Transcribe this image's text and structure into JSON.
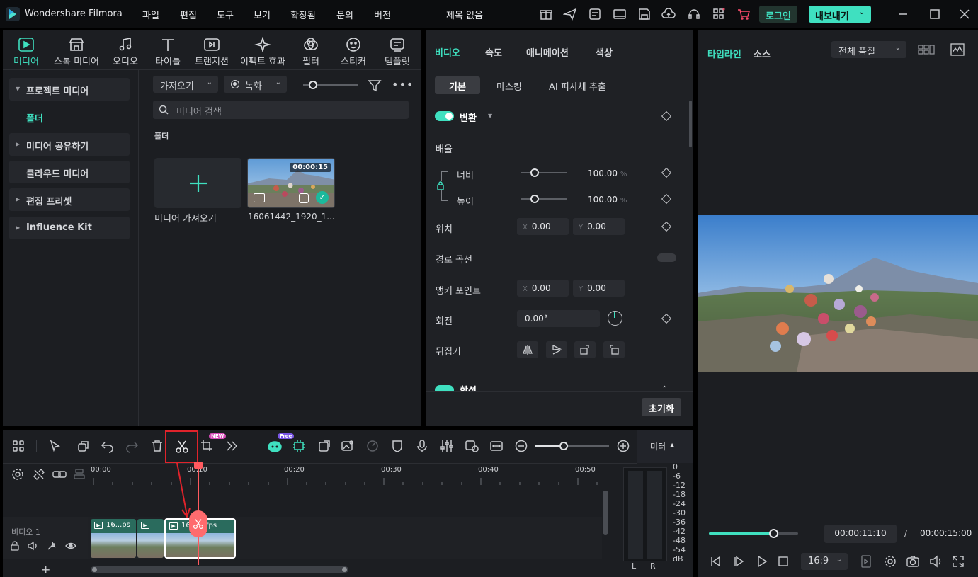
{
  "app": {
    "name": "Wondershare Filmora",
    "project_title": "제목 없음",
    "login_label": "로그인",
    "export_label": "내보내기"
  },
  "menu": [
    "파일",
    "편집",
    "도구",
    "보기",
    "확장됨",
    "문의",
    "버전"
  ],
  "tool_tabs": [
    "미디어",
    "스톡 미디어",
    "오디오",
    "타이틀",
    "트랜지션",
    "이펙트 효과",
    "필터",
    "스티커",
    "템플릿"
  ],
  "sidebar": {
    "project_media": "프로젝트 미디어",
    "folder": "폴더",
    "share_media": "미디어 공유하기",
    "cloud_media": "클라우드 미디어",
    "edit_preset": "편집 프리셋",
    "influence_kit": "Influence Kit"
  },
  "media": {
    "import_label": "가져오기",
    "record_label": "녹화",
    "search_placeholder": "미디어 검색",
    "folder_heading": "폴더",
    "import_media_label": "미디어 가져오기",
    "clip_name": "16061442_1920_1...",
    "clip_duration": "00:00:15"
  },
  "properties": {
    "tabs": [
      "비디오",
      "속도",
      "애니메이션",
      "색상"
    ],
    "subtabs": [
      "기본",
      "마스킹",
      "AI 피사체 추출"
    ],
    "transform_label": "변환",
    "scale_label": "배율",
    "width_label": "너비",
    "height_label": "높이",
    "width_value": "100.00",
    "height_value": "100.00",
    "percent_unit": "%",
    "position_label": "위치",
    "position_x": "0.00",
    "position_y": "0.00",
    "axis_x": "X",
    "axis_y": "Y",
    "path_curve_label": "경로 곡선",
    "anchor_label": "앵커 포인트",
    "anchor_x": "0.00",
    "anchor_y": "0.00",
    "rotate_label": "회전",
    "rotate_value": "0.00°",
    "flip_label": "뒤집기",
    "composite_label": "합성",
    "reset_label": "초기화"
  },
  "preview": {
    "tabs": [
      "타임라인",
      "소스"
    ],
    "quality_label": "전체 품질",
    "current_time": "00:00:11:10",
    "separator": "/",
    "total_time": "00:00:15:00",
    "aspect_ratio": "16:9",
    "progress": 0.72
  },
  "timeline": {
    "meter_label": "미터",
    "new_badge": "NEW",
    "free_badge": "Free",
    "ruler": [
      "00:00",
      "00:10",
      "00:20",
      "00:30",
      "00:40",
      "00:50"
    ],
    "track_label": "비디오 1",
    "clips": [
      "16...ps",
      "",
      "16...60fps"
    ],
    "db_scale": [
      "0",
      "-6",
      "-12",
      "-18",
      "-24",
      "-30",
      "-36",
      "-42",
      "-48",
      "-54",
      "dB"
    ],
    "channels": [
      "L",
      "R"
    ]
  },
  "colors": {
    "accent": "#3fe0c0",
    "highlight": "#e0232b",
    "playhead": "#ff5a5f"
  }
}
